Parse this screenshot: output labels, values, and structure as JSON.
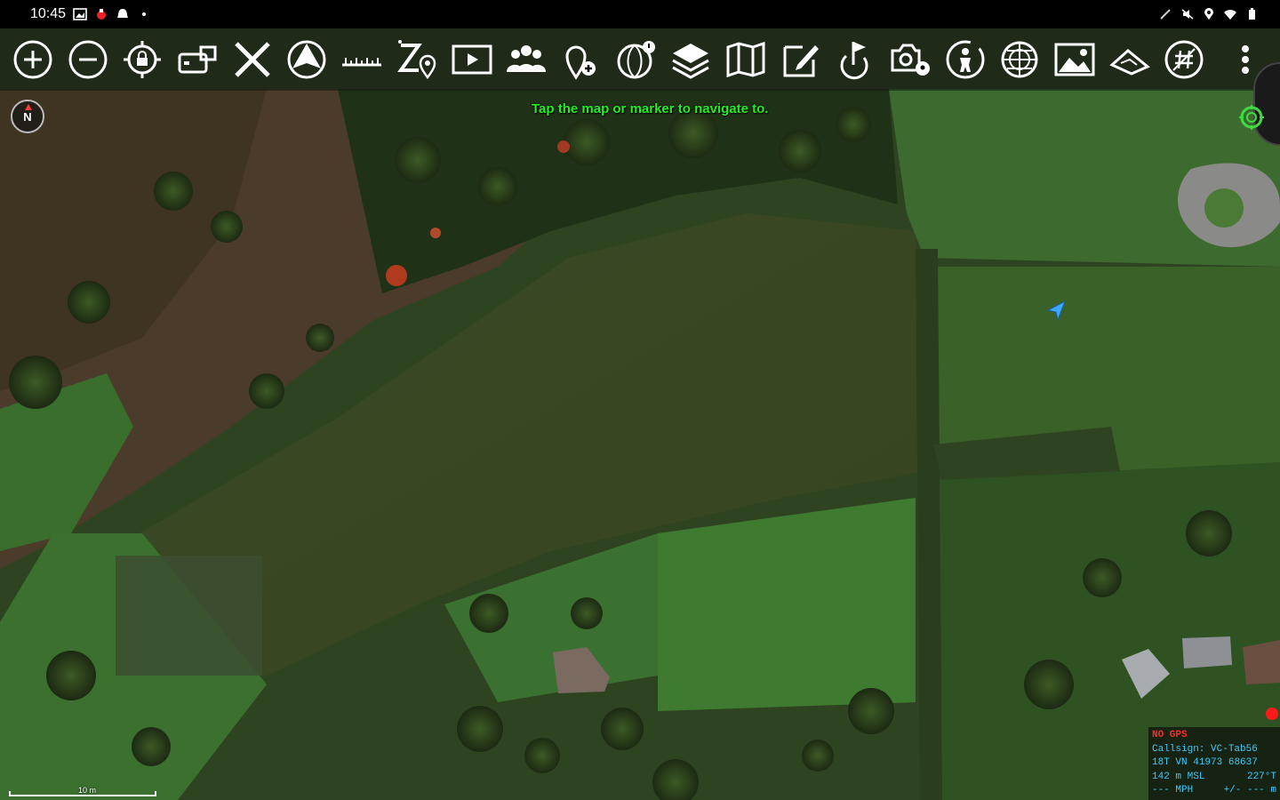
{
  "status_bar": {
    "time": "10:45"
  },
  "toolbar": {
    "buttons": [
      {
        "name": "zoom-in",
        "icon": "plus-circle-icon"
      },
      {
        "name": "zoom-out",
        "icon": "minus-circle-icon"
      },
      {
        "name": "my-location",
        "icon": "locate-lock-icon"
      },
      {
        "name": "track-up",
        "icon": "rotate-screen-icon"
      },
      {
        "name": "clear",
        "icon": "close-x-icon"
      },
      {
        "name": "nav-mode",
        "icon": "navigation-cone-icon"
      },
      {
        "name": "measure",
        "icon": "ruler-icon"
      },
      {
        "name": "zoom-to",
        "icon": "zoom-marker-icon"
      },
      {
        "name": "video",
        "icon": "video-play-icon"
      },
      {
        "name": "contacts",
        "icon": "group-people-icon"
      },
      {
        "name": "add-point",
        "icon": "add-pin-icon"
      },
      {
        "name": "geo-fence",
        "icon": "globe-alert-icon"
      },
      {
        "name": "overlays",
        "icon": "layers-icon"
      },
      {
        "name": "maps",
        "icon": "folded-map-icon"
      },
      {
        "name": "notes",
        "icon": "edit-note-icon"
      },
      {
        "name": "route",
        "icon": "flag-route-icon"
      },
      {
        "name": "camera",
        "icon": "camera-geo-icon"
      },
      {
        "name": "emergency",
        "icon": "person-circle-icon"
      },
      {
        "name": "grid",
        "icon": "reticle-globe-icon"
      },
      {
        "name": "imagery",
        "icon": "image-icon"
      },
      {
        "name": "elevation",
        "icon": "terrain-shape-icon"
      },
      {
        "name": "grg",
        "icon": "hash-circle-icon"
      }
    ],
    "overflow_icon": "more-vert-icon"
  },
  "map": {
    "compass_label": "N",
    "hint_text": "Tap the map or marker to navigate to.",
    "scale_label": "10 m"
  },
  "info_panel": {
    "gps_status": "NO GPS",
    "callsign": "Callsign: VC-Tab56",
    "grid_zone": "18T",
    "grid_square": "VN",
    "easting": "41973",
    "northing": "68637",
    "elevation": "142 m MSL",
    "heading": "227°T",
    "speed": "--- MPH",
    "accuracy": "+/- --- m"
  }
}
